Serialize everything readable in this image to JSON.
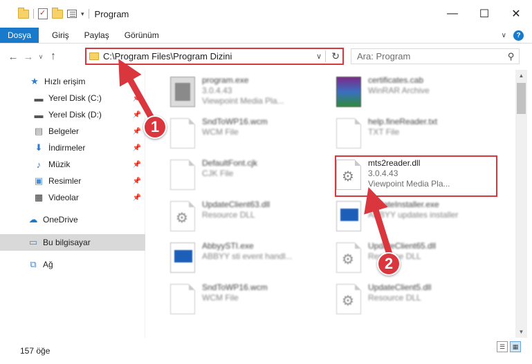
{
  "window": {
    "title": "Program",
    "controls": {
      "minimize": "—",
      "maximize": "☐",
      "close": "✕"
    }
  },
  "ribbon": {
    "tabs": [
      "Dosya",
      "Giriş",
      "Paylaş",
      "Görünüm"
    ],
    "accent": "#1979ca"
  },
  "address": {
    "path": "C:\\Program Files\\Program Dizini",
    "search_placeholder": "Ara: Program"
  },
  "nav": {
    "items": [
      {
        "label": "Hızlı erişim",
        "icon": "star-icon",
        "pinned": false
      },
      {
        "label": "Yerel Disk (C:)",
        "icon": "drive-icon",
        "pinned": true
      },
      {
        "label": "Yerel Disk (D:)",
        "icon": "drive-icon",
        "pinned": true
      },
      {
        "label": "Belgeler",
        "icon": "documents-icon",
        "pinned": true
      },
      {
        "label": "İndirmeler",
        "icon": "download-icon",
        "pinned": true
      },
      {
        "label": "Müzik",
        "icon": "music-icon",
        "pinned": true
      },
      {
        "label": "Resimler",
        "icon": "pictures-icon",
        "pinned": true
      },
      {
        "label": "Videolar",
        "icon": "videos-icon",
        "pinned": true
      },
      {
        "label": "OneDrive",
        "icon": "cloud-icon",
        "pinned": false
      },
      {
        "label": "Bu bilgisayar",
        "icon": "computer-icon",
        "pinned": false,
        "selected": true
      },
      {
        "label": "Ağ",
        "icon": "network-icon",
        "pinned": false
      }
    ]
  },
  "files": [
    {
      "name": "program.exe",
      "line2": "3.0.4.43",
      "line3": "Viewpoint Media Pla...",
      "icon": "exe-icon"
    },
    {
      "name": "certificates.cab",
      "line2": "WinRAR Archive",
      "line3": "",
      "icon": "archive-icon"
    },
    {
      "name": "SndToWP16.wcm",
      "line2": "WCM File",
      "line3": "",
      "icon": "file-icon"
    },
    {
      "name": "help.fineReader.txt",
      "line2": "TXT File",
      "line3": "",
      "icon": "file-icon"
    },
    {
      "name": "DefaultFont.cjk",
      "line2": "CJK File",
      "line3": "",
      "icon": "file-icon"
    },
    {
      "name": "mts2reader.dll",
      "line2": "3.0.4.43",
      "line3": "Viewpoint Media Pla...",
      "icon": "dll-icon"
    },
    {
      "name": "UpdateClient63.dll",
      "line2": "Resource DLL",
      "line3": "",
      "icon": "dll-icon"
    },
    {
      "name": "UpdateInstaller.exe",
      "line2": "ABBYY updates installer",
      "line3": "",
      "icon": "app-icon"
    },
    {
      "name": "AbbyySTI.exe",
      "line2": "ABBYY sti event handl...",
      "line3": "",
      "icon": "app-icon"
    },
    {
      "name": "UpdateClient65.dll",
      "line2": "Resource DLL",
      "line3": "",
      "icon": "dll-icon"
    },
    {
      "name": "SndToWP16.wcm",
      "line2": "WCM File",
      "line3": "",
      "icon": "file-icon"
    },
    {
      "name": "UpdateClient5.dll",
      "line2": "Resource DLL",
      "line3": "",
      "icon": "dll-icon"
    }
  ],
  "status": {
    "count": "157 öğe"
  },
  "annotations": {
    "step1": "1",
    "step2": "2",
    "color": "#d9363e"
  }
}
